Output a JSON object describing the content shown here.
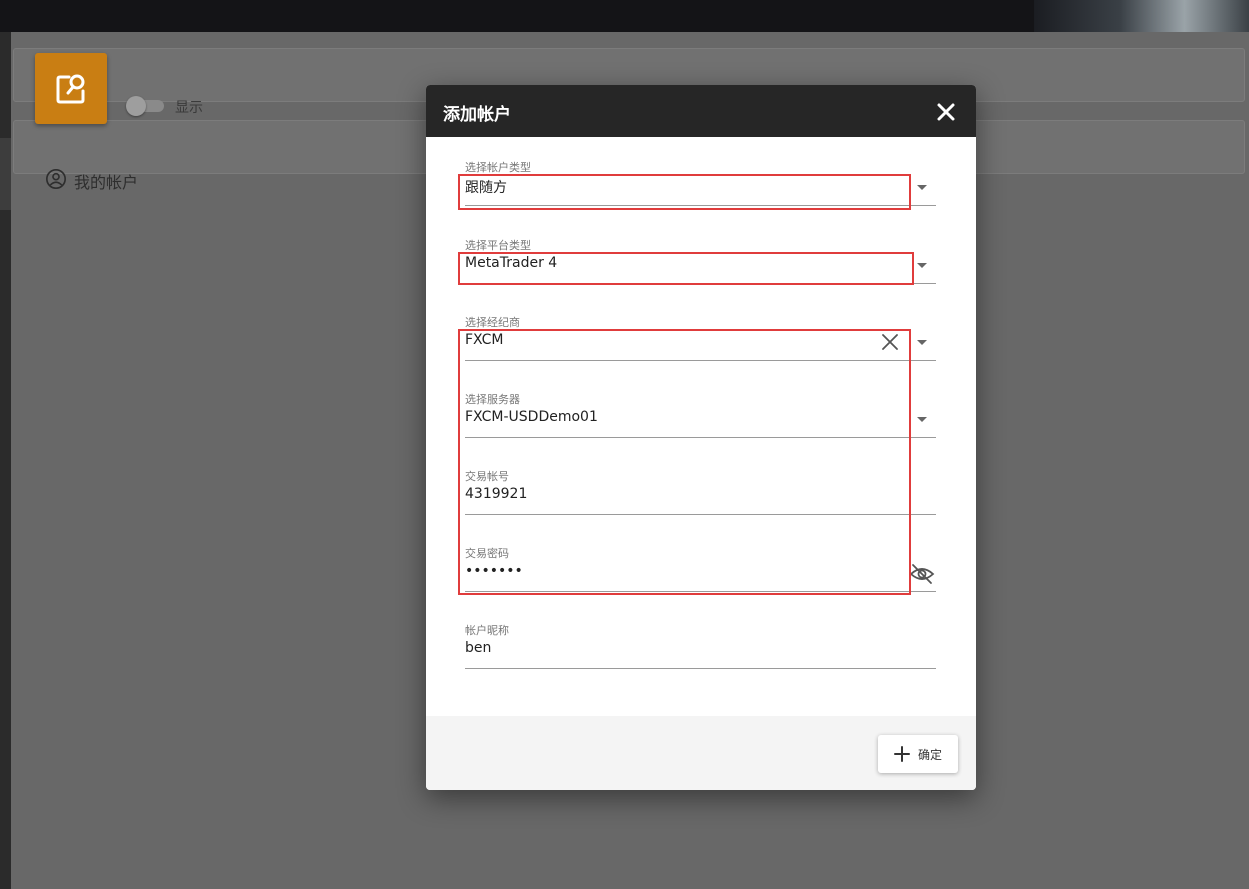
{
  "background": {
    "show_toggle_label": "显示",
    "my_accounts_title": "我的帐户"
  },
  "dialog": {
    "title": "添加帐户",
    "fields": {
      "account_type": {
        "label": "选择帐户类型",
        "value": "跟随方"
      },
      "platform_type": {
        "label": "选择平台类型",
        "value": "MetaTrader 4"
      },
      "broker": {
        "label": "选择经纪商",
        "value": "FXCM"
      },
      "server": {
        "label": "选择服务器",
        "value": "FXCM-USDDemo01"
      },
      "trade_account": {
        "label": "交易帐号",
        "value": "4319921"
      },
      "trade_password": {
        "label": "交易密码",
        "value": "•••••••"
      },
      "nickname": {
        "label": "帐户昵称",
        "value": "ben"
      }
    },
    "confirm_label": "确定"
  },
  "colors": {
    "accent_orange": "#c97e13",
    "dialog_header": "#262626",
    "highlight_red": "#e03c3c"
  },
  "icons": [
    "edit-search-icon",
    "account-circle-icon",
    "close-icon",
    "dropdown-caret-icon",
    "clear-icon",
    "eye-off-icon",
    "plus-icon"
  ]
}
